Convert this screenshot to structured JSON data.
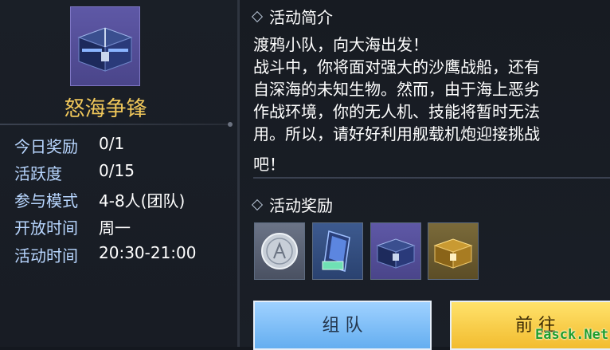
{
  "event": {
    "title": "怒海争锋",
    "info": [
      {
        "label": "今日奖励",
        "value": "0/1"
      },
      {
        "label": "活跃度",
        "value": "0/15"
      },
      {
        "label": "参与模式",
        "value": "4-8人(团队)"
      },
      {
        "label": "开放时间",
        "value": "周一"
      },
      {
        "label": "活动时间",
        "value": "20:30-21:00"
      }
    ]
  },
  "intro": {
    "heading": "活动简介",
    "lines": [
      "渡鸦小队，向大海出发！",
      "战斗中，你将面对强大的沙鹰战船，还有",
      "自深海的未知生物。然而，由于海上恶劣",
      "作战环境，你的无人机、技能将暂时无法",
      "用。所以，请好好利用舰载机炮迎接挑战",
      "吧！"
    ]
  },
  "rewards": {
    "heading": "活动奖励",
    "items": [
      {
        "icon": "silver-coin-icon"
      },
      {
        "icon": "blueprint-card-icon"
      },
      {
        "icon": "blue-chest-icon"
      },
      {
        "icon": "gold-chest-icon"
      }
    ]
  },
  "buttons": {
    "team": "组 队",
    "go": "前 往"
  },
  "watermark": "Easck.Net",
  "colors": {
    "title_gold": "#f0c75a",
    "label_blue": "#b8d6ff",
    "button_blue": "#7fbff7",
    "button_yellow": "#f7cd45"
  }
}
